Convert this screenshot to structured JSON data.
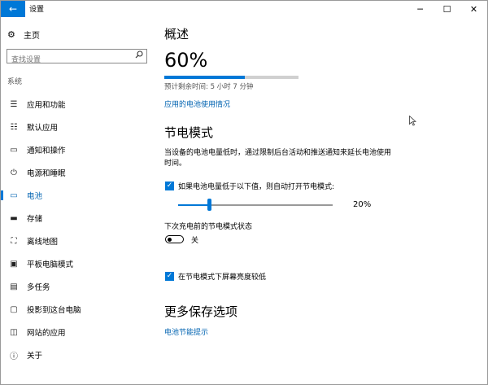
{
  "window": {
    "title": "设置",
    "back_glyph": "←",
    "minimize_glyph": "─",
    "maximize_glyph": "☐",
    "close_glyph": "✕"
  },
  "sidebar": {
    "home": {
      "label": "主页",
      "icon": "gear-icon"
    },
    "search": {
      "placeholder": "查找设置",
      "icon": "search-icon"
    },
    "section": "系统",
    "items": [
      {
        "label": "应用和功能",
        "icon": "apps-list-icon",
        "active": false
      },
      {
        "label": "默认应用",
        "icon": "default-apps-icon",
        "active": false
      },
      {
        "label": "通知和操作",
        "icon": "notification-icon",
        "active": false
      },
      {
        "label": "电源和睡眠",
        "icon": "power-icon",
        "active": false
      },
      {
        "label": "电池",
        "icon": "battery-icon",
        "active": true
      },
      {
        "label": "存储",
        "icon": "storage-icon",
        "active": false
      },
      {
        "label": "离线地图",
        "icon": "map-icon",
        "active": false
      },
      {
        "label": "平板电脑模式",
        "icon": "tablet-icon",
        "active": false
      },
      {
        "label": "多任务",
        "icon": "multitask-icon",
        "active": false
      },
      {
        "label": "投影到这台电脑",
        "icon": "project-icon",
        "active": false
      },
      {
        "label": "网站的应用",
        "icon": "web-apps-icon",
        "active": false
      },
      {
        "label": "关于",
        "icon": "info-icon",
        "active": false
      }
    ]
  },
  "overview": {
    "heading": "概述",
    "percent_text": "60%",
    "percent_value": 60,
    "remaining": "预计剩余时间: 5 小时 7 分钟",
    "usage_link": "应用的电池使用情况"
  },
  "saver": {
    "heading": "节电模式",
    "description": "当设备的电池电量低时，通过限制后台活动和推送通知来延长电池使用时间。",
    "auto_on_label": "如果电池电量低于以下值，则自动打开节电模式:",
    "auto_on_checked": true,
    "threshold_text": "20%",
    "threshold_value": 20,
    "status_label": "下次充电前的节电模式状态",
    "toggle_state_text": "关",
    "toggle_on": false,
    "lower_brightness_label": "在节电模式下屏幕亮度较低",
    "lower_brightness_checked": true
  },
  "more": {
    "heading": "更多保存选项",
    "tips_link": "电池节能提示"
  },
  "colors": {
    "accent": "#0078d7",
    "link": "#0063b1"
  }
}
